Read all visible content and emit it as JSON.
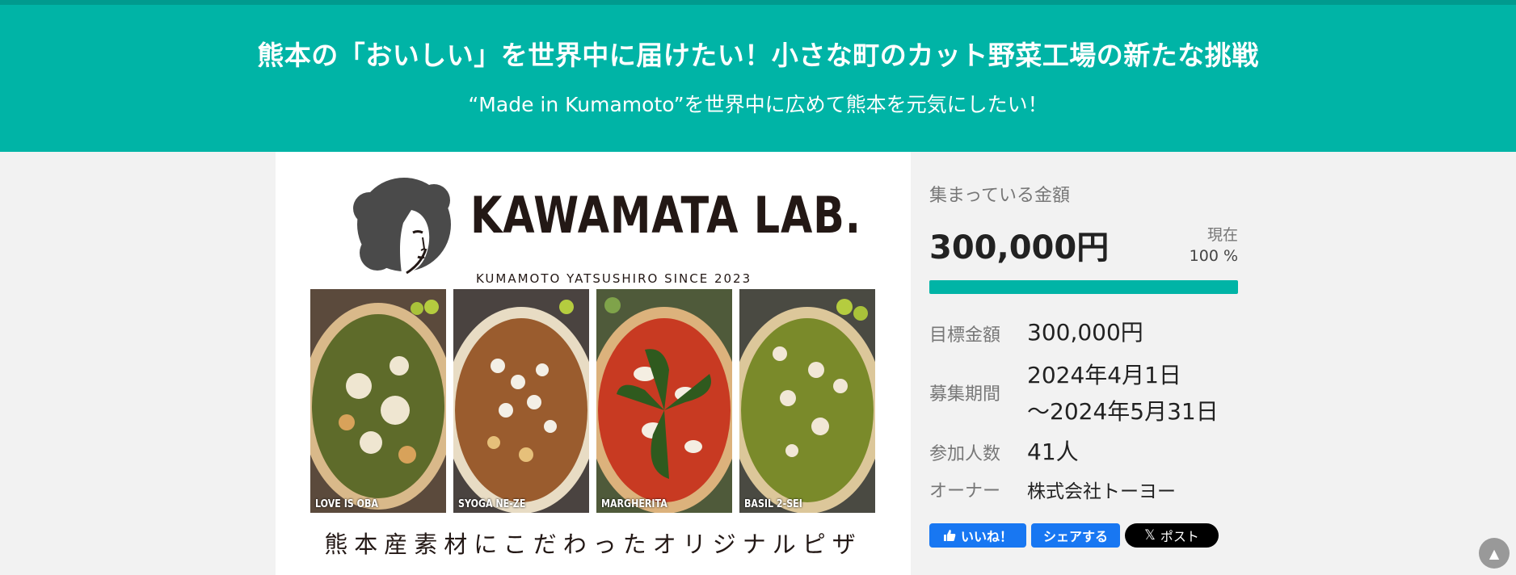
{
  "hero": {
    "title": "熊本の「おいしい」を世界中に届けたい！小さな町のカット野菜工場の新たな挑戦",
    "subtitle": "“Made in Kumamoto”を世界中に広めて熊本を元気にしたい！"
  },
  "media": {
    "logo_text": "KAWAMATA LAB.",
    "logo_tagline": "KUMAMOTO YATSUSHIRO SINCE 2023",
    "pizzas": [
      {
        "name": "LOVE IS OBA"
      },
      {
        "name": "SYOGA NE-ZE"
      },
      {
        "name": "MARGHERITA"
      },
      {
        "name": "BASIL 2-SEI"
      }
    ],
    "caption": "熊本産素材にこだわったオリジナルピザ"
  },
  "funding": {
    "collected_label": "集まっている金額",
    "amount": "300,000円",
    "current_label": "現在",
    "percent_text": "100 %",
    "progress_fraction": 1.0,
    "accent_color": "#00b4a6",
    "rows": {
      "goal": {
        "label": "目標金額",
        "value": "300,000円"
      },
      "period": {
        "label": "募集期間",
        "value_line1": "2024年4月1日",
        "value_line2": "～2024年5月31日"
      },
      "participants": {
        "label": "参加人数",
        "value": "41人"
      },
      "owner": {
        "label": "オーナー",
        "value": "株式会社トーヨー"
      }
    }
  },
  "social": {
    "like_label": "いいね！",
    "share_label": "シェアする",
    "post_label": "ポスト"
  },
  "scroll_top_icon": "▲"
}
